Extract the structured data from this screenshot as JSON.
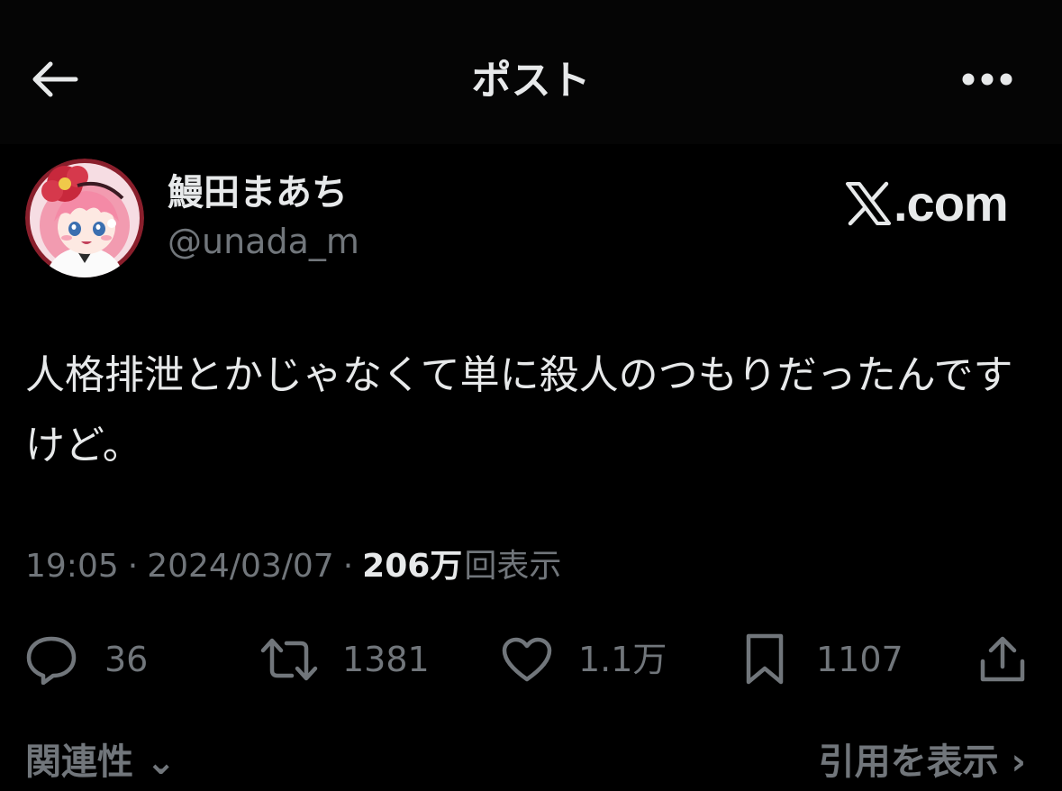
{
  "header": {
    "title": "ポスト",
    "back_icon": "arrow-left-icon",
    "more_icon": "more-horizontal-icon"
  },
  "author": {
    "display_name": "鰻田まあち",
    "handle": "@unada_m"
  },
  "watermark": {
    "text": ".com",
    "logo_icon": "x-logo-icon"
  },
  "tweet": {
    "text": "人格排泄とかじゃなくて単に殺人のつもりだったんですけど。"
  },
  "meta": {
    "time": "19:05",
    "separator": "·",
    "date": "2024/03/07",
    "views_count": "206万",
    "views_label": "回表示"
  },
  "actions": {
    "reply_count": "36",
    "retweet_count": "1381",
    "like_count": "1.1万",
    "bookmark_count": "1107"
  },
  "footer": {
    "related": "関連性 ⌄",
    "quotes": "引用を表示 ›"
  },
  "colors": {
    "background": "#000000",
    "primary_text": "#e7e9ea",
    "secondary_text": "#71767b",
    "avatar_hair": "#f29bb0",
    "avatar_flower": "#c8283c"
  }
}
